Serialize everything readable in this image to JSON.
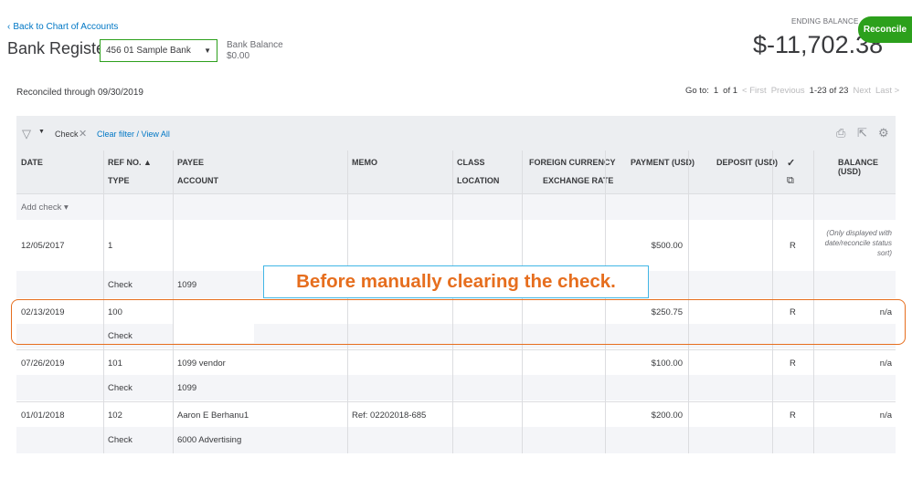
{
  "header": {
    "back_link": "Back to Chart of Accounts",
    "title": "Bank Register",
    "account_select": "456 01 Sample Bank",
    "bank_balance_label": "Bank Balance",
    "bank_balance_value": "$0.00",
    "ending_balance_label": "ENDING BALANCE",
    "ending_balance_value": "$-11,702.38",
    "reconcile_button": "Reconcile"
  },
  "reconciled_through": "Reconciled through 09/30/2019",
  "pager": {
    "goto_label": "Go to:",
    "page": "1",
    "of_label": "of 1",
    "first": "< First",
    "previous": "Previous",
    "range": "1-23 of 23",
    "next": "Next",
    "last": "Last >"
  },
  "filter": {
    "dropdown_text": "Check",
    "clear_link": "Clear filter / View All"
  },
  "columns": {
    "date": "DATE",
    "ref": "REF NO. ▲",
    "type": "TYPE",
    "payee": "PAYEE",
    "account": "ACCOUNT",
    "memo": "MEMO",
    "class": "CLASS",
    "location": "LOCATION",
    "fx_currency": "FOREIGN CURRENCY",
    "fx_rate": "EXCHANGE RATE",
    "payment": "PAYMENT (USD)",
    "deposit": "DEPOSIT (USD)",
    "check_mark": "✓",
    "balance": "BALANCE (USD)"
  },
  "add_check": "Add check ▾",
  "rows": [
    {
      "date": "12/05/2017",
      "ref": "1",
      "type": "Check",
      "payee": "",
      "account": "1099",
      "memo": "",
      "payment": "$500.00",
      "status": "R",
      "balance": "(Only displayed with date/reconcile status sort)"
    },
    {
      "date": "02/13/2019",
      "ref": "100",
      "type": "Check",
      "payee": "",
      "account": "",
      "memo": "",
      "payment": "$250.75",
      "status": "R",
      "balance": "n/a"
    },
    {
      "date": "07/26/2019",
      "ref": "101",
      "type": "Check",
      "payee": "1099 vendor",
      "account": "1099",
      "memo": "",
      "payment": "$100.00",
      "status": "R",
      "balance": "n/a"
    },
    {
      "date": "01/01/2018",
      "ref": "102",
      "type": "Check",
      "payee": "Aaron E Berhanu1",
      "account": "6000 Advertising",
      "memo": "Ref: 02202018-685",
      "payment": "$200.00",
      "status": "R",
      "balance": "n/a"
    }
  ],
  "callout_text": "Before manually clearing the check.",
  "colors": {
    "accent_green": "#2ca01c",
    "link_blue": "#0077c5",
    "highlight_orange": "#e66e1e",
    "callout_border": "#41b6e6"
  }
}
